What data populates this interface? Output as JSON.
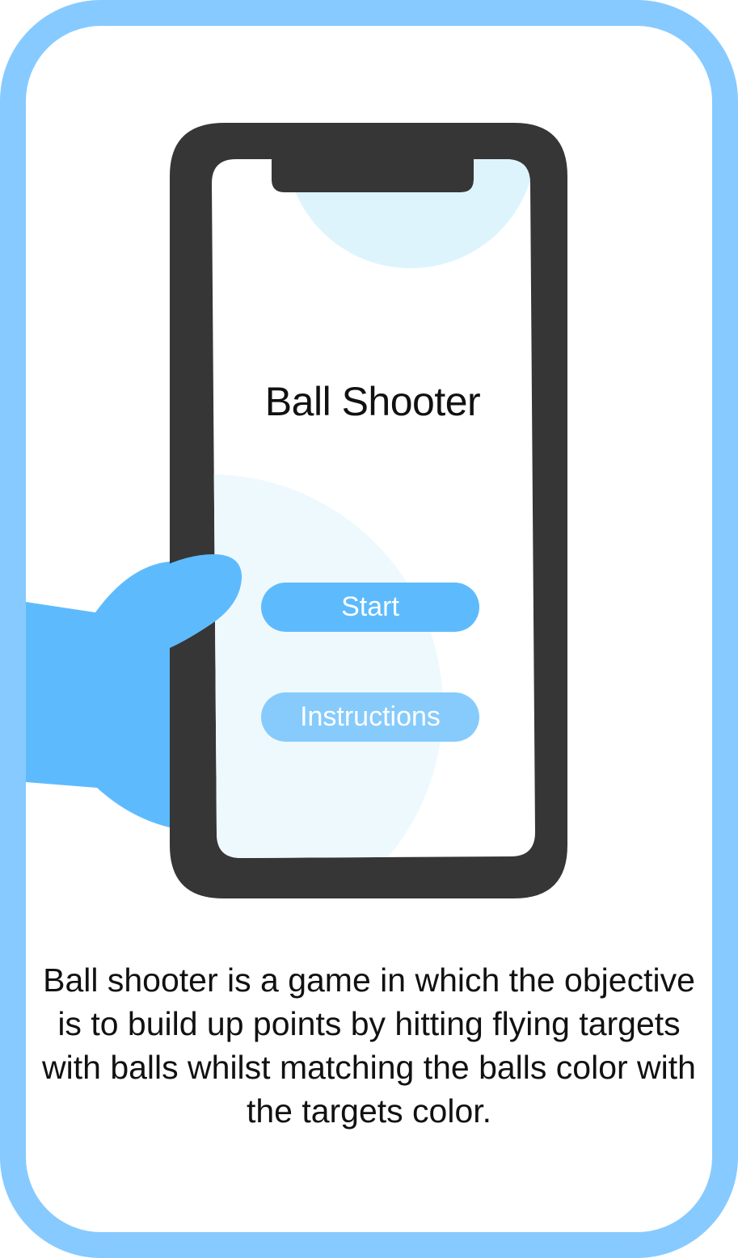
{
  "app": {
    "title": "Ball Shooter",
    "buttons": {
      "start_label": "Start",
      "instructions_label": "Instructions"
    }
  },
  "description": {
    "text": "Ball shooter is a game in which the objective is to build up points by hitting flying targets with balls whilst matching the balls color with the targets color."
  },
  "colors": {
    "card_border": "#87caff",
    "phone_body": "#363636",
    "hand": "#5dbbfd",
    "start_button": "#5dbbfd",
    "instructions_button": "#86cbfc",
    "bubble_top": "#ddf4fd",
    "bubble_bottom": "#eef9fe"
  }
}
